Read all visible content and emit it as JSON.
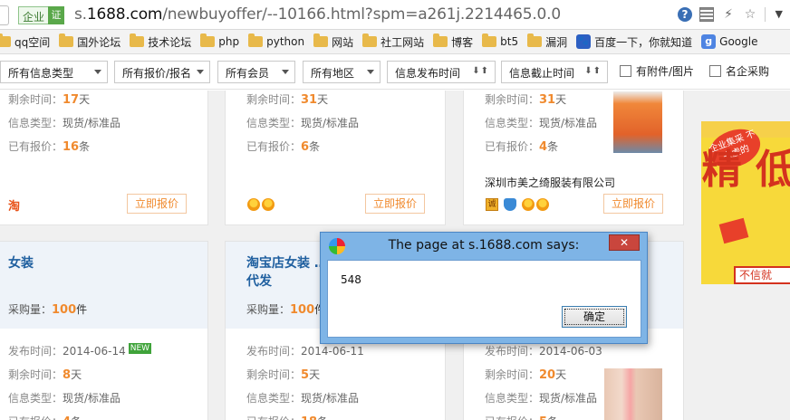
{
  "address_bar": {
    "ev_label": "企业",
    "ev_badge": "证",
    "url_prefix": "s.",
    "url_host": "1688.com",
    "url_path": "/newbuyoffer/--10166.html?spm=a261j.2214465.0.0"
  },
  "bookmarks": [
    {
      "label": "qq空间",
      "icon": "folder-icon"
    },
    {
      "label": "国外论坛",
      "icon": "folder-icon"
    },
    {
      "label": "技术论坛",
      "icon": "folder-icon"
    },
    {
      "label": "php",
      "icon": "folder-icon"
    },
    {
      "label": "python",
      "icon": "folder-icon"
    },
    {
      "label": "网站",
      "icon": "folder-icon"
    },
    {
      "label": "社工网站",
      "icon": "folder-icon"
    },
    {
      "label": "博客",
      "icon": "folder-icon"
    },
    {
      "label": "bt5",
      "icon": "folder-icon"
    },
    {
      "label": "漏洞",
      "icon": "folder-icon"
    },
    {
      "label": "百度一下，你就知道",
      "icon": "paw-icon"
    },
    {
      "label": "Google",
      "icon": "g-icon"
    }
  ],
  "filters": {
    "info_type": "所有信息类型",
    "quote_status": "所有报价/报名",
    "members": "所有会员",
    "region": "所有地区",
    "publish_time": "信息发布时间",
    "deadline": "信息截止时间",
    "with_attachment": "有附件/图片",
    "famous_company": "名企采购"
  },
  "labels": {
    "remaining": "剩余时间：",
    "info_type": "信息类型：",
    "quoted": "已有报价：",
    "purchase_qty": "采购量：",
    "publish_time": "发布时间：",
    "day_unit": "天",
    "count_unit": "条",
    "piece_unit": "件",
    "spot": "现货/标准品",
    "quote_button": "立即报价",
    "new_badge": "NEW"
  },
  "cards_top": [
    {
      "remaining": "17",
      "quotes": "16",
      "taobao": "淘"
    },
    {
      "remaining": "31",
      "quotes": "6"
    },
    {
      "remaining": "31",
      "quotes": "4",
      "company": "深圳市美之绮服装有限公司"
    }
  ],
  "cards_bottom": [
    {
      "title": "女装",
      "qty": "100",
      "date": "2014-06-14",
      "remaining": "8",
      "quotes": "4"
    },
    {
      "title": "淘宝店女装 …",
      "title2": "代发",
      "qty": "100",
      "date": "2014-06-11",
      "remaining": "5",
      "quotes": "18"
    },
    {
      "date": "2014-06-03",
      "remaining": "20",
      "quotes": "5"
    }
  ],
  "ad": {
    "badge": "企业集采 不来虚的",
    "big_text": "精 低",
    "bottom": "不信就"
  },
  "dialog": {
    "title": "The page at s.1688.com says:",
    "message": "548",
    "ok_label": "确定",
    "close_label": "✕"
  }
}
